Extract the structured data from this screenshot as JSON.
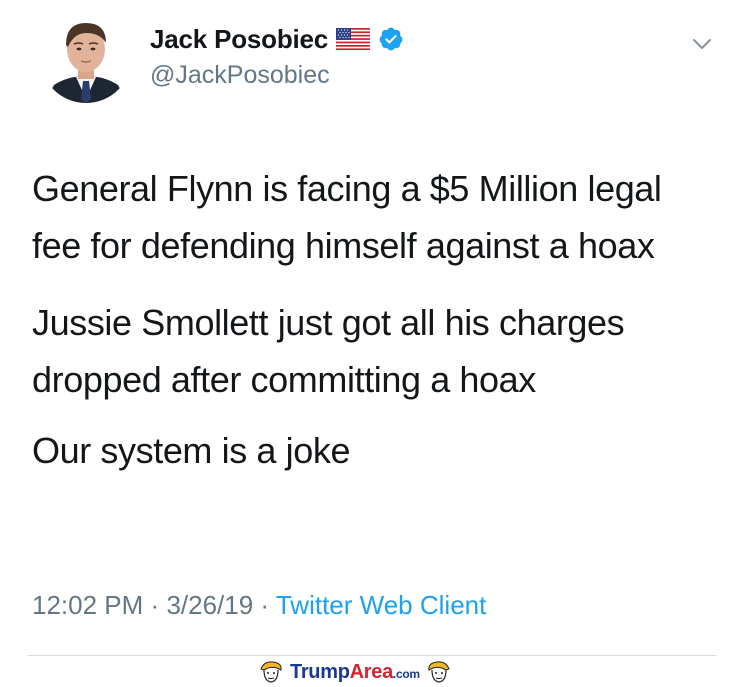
{
  "author": {
    "display_name": "Jack Posobiec",
    "handle": "@JackPosobiec",
    "flag_icon": "us-flag-icon",
    "verified_icon": "verified-badge-icon",
    "verified_color": "#1da1f2"
  },
  "tweet": {
    "paragraphs": [
      "General Flynn is facing a $5 Million legal fee for defending himself against a hoax",
      "Jussie Smollett just got all his charges dropped after committing a hoax",
      "Our system is a joke"
    ]
  },
  "meta": {
    "time": "12:02 PM",
    "separator": "·",
    "date": "3/26/19",
    "source": "Twitter Web Client"
  },
  "watermark": {
    "part1": "Trump",
    "part2": "Area",
    "part3": ".com"
  },
  "colors": {
    "text": "#14171a",
    "secondary": "#657786",
    "link": "#1da1f2"
  }
}
